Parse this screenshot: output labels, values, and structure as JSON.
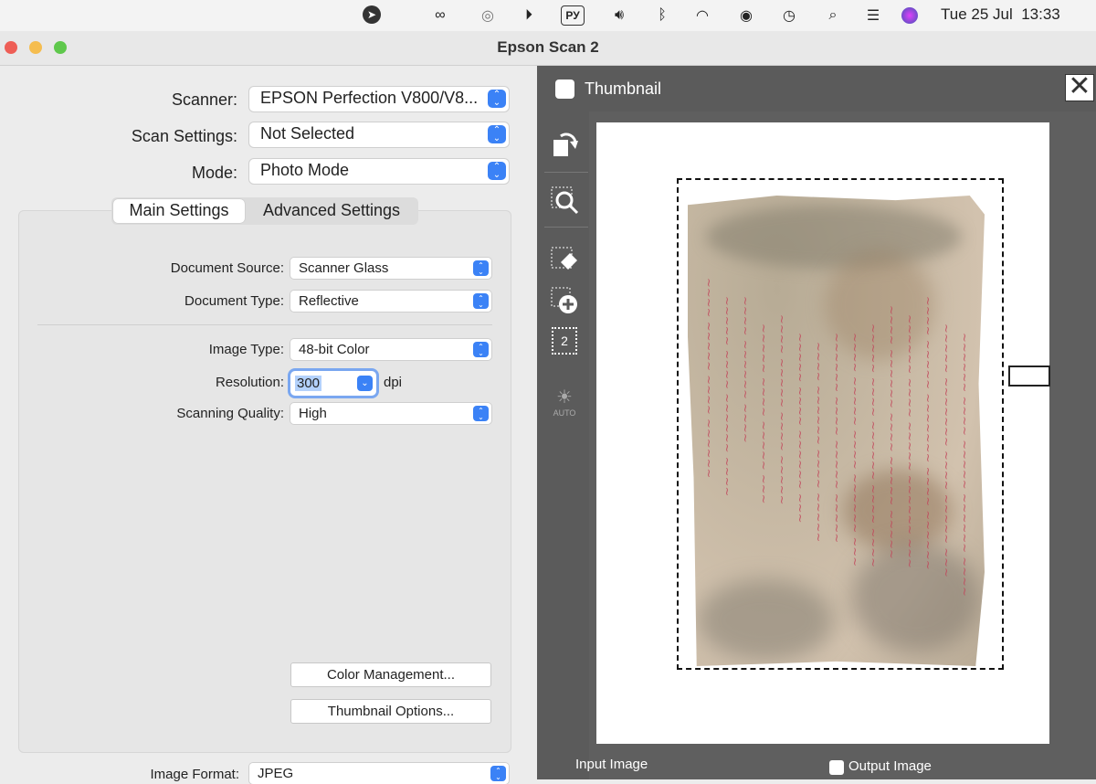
{
  "menubar": {
    "icons": [
      "location-arrow-icon",
      "creative-cloud-icon",
      "airdrop-icon",
      "play-icon",
      "keyboard-layout-icon",
      "volume-icon",
      "bluetooth-icon",
      "wifi-icon",
      "user-icon",
      "time-machine-icon",
      "spotlight-icon",
      "control-center-icon",
      "siri-icon"
    ],
    "keyboard_layout": "РУ",
    "date": "Tue 25 Jul",
    "time": "13:33"
  },
  "window": {
    "title": "Epson Scan 2"
  },
  "left": {
    "scanner_label": "Scanner:",
    "scanner_value": "EPSON Perfection V800/V8...",
    "scan_settings_label": "Scan Settings:",
    "scan_settings_value": "Not Selected",
    "mode_label": "Mode:",
    "mode_value": "Photo Mode",
    "tabs": {
      "main": "Main Settings",
      "advanced": "Advanced Settings"
    },
    "main": {
      "document_source_label": "Document Source:",
      "document_source_value": "Scanner Glass",
      "document_type_label": "Document Type:",
      "document_type_value": "Reflective",
      "image_type_label": "Image Type:",
      "image_type_value": "48-bit Color",
      "resolution_label": "Resolution:",
      "resolution_value": "300",
      "resolution_unit": "dpi",
      "scanning_quality_label": "Scanning Quality:",
      "scanning_quality_value": "High",
      "color_management_button": "Color Management...",
      "thumbnail_options_button": "Thumbnail Options..."
    },
    "image_format_label": "Image Format:",
    "image_format_value": "JPEG"
  },
  "right": {
    "thumbnail_label": "Thumbnail",
    "close_symbol": "✕",
    "tools": [
      "rotate-icon",
      "zoom-icon",
      "eraser-icon",
      "add-marquee-icon",
      "marquee-count-icon",
      "auto-exposure-icon"
    ],
    "marquee_count": "2",
    "auto_label": "AUTO",
    "input_image_label": "Input Image",
    "output_image_label": "Output Image"
  }
}
